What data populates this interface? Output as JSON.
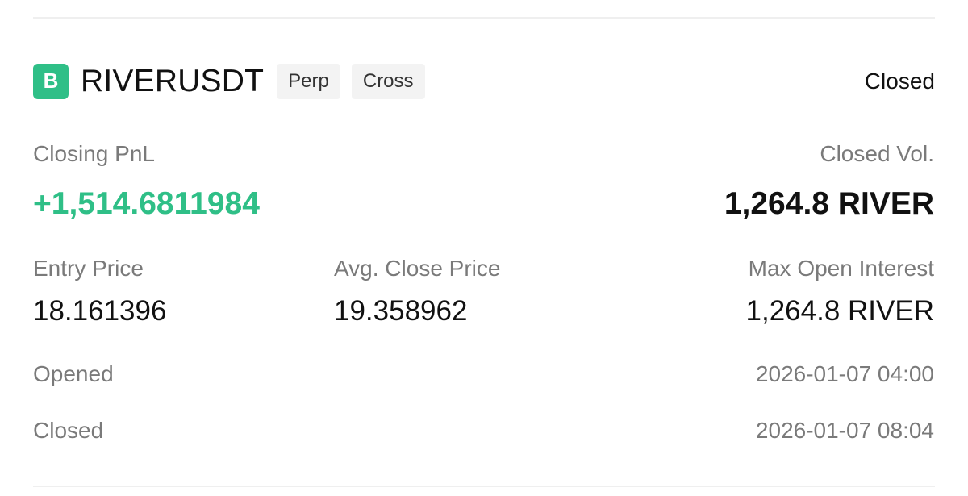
{
  "header": {
    "icon_letter": "B",
    "symbol": "RIVERUSDT",
    "tags": [
      "Perp",
      "Cross"
    ],
    "status": "Closed"
  },
  "pnl": {
    "label": "Closing PnL",
    "value": "+1,514.6811984"
  },
  "closed_vol": {
    "label": "Closed Vol.",
    "value": "1,264.8 RIVER"
  },
  "entry_price": {
    "label": "Entry Price",
    "value": "18.161396"
  },
  "avg_close_price": {
    "label": "Avg. Close Price",
    "value": "19.358962"
  },
  "max_open_interest": {
    "label": "Max Open Interest",
    "value": "1,264.8 RIVER"
  },
  "opened": {
    "label": "Opened",
    "value": "2026-01-07 04:00"
  },
  "closed": {
    "label": "Closed",
    "value": "2026-01-07 08:04"
  },
  "colors": {
    "accent_green": "#2fbf87",
    "label_gray": "#7a7a7a",
    "tag_bg": "#f3f3f3"
  }
}
